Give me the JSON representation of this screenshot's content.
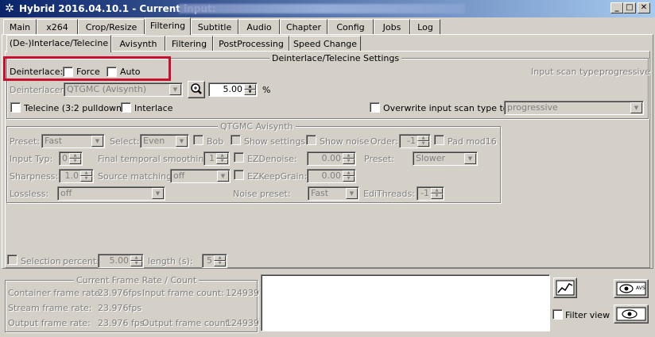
{
  "window": {
    "title": "Hybrid 2016.04.10.1 - Current input:"
  },
  "main_tabs": [
    "Main",
    "x264",
    "Crop/Resize",
    "Filtering",
    "Subtitle",
    "Audio",
    "Chapter",
    "Config",
    "Jobs",
    "Log"
  ],
  "sub_tabs": [
    "(De-)Interlace/Telecine",
    "Avisynth",
    "Filtering",
    "PostProcessing",
    "Speed Change"
  ],
  "deint": {
    "group_title": "Deinterlace/Telecine Settings",
    "deinterlace_label": "Deinterlace:",
    "force_label": "Force",
    "auto_label": "Auto",
    "input_scan_label": "Input scan type:",
    "input_scan_value": "progressive",
    "deinterlacer_label": "Deinterlacer:",
    "deinterlacer_value": "QTGMC (Avisynth)",
    "percent_value": "5.00",
    "percent_label": "%",
    "telecine_label": "Telecine (3:2 pulldown)",
    "interlace_label": "Interlace",
    "overwrite_label": "Overwrite input scan type to:",
    "overwrite_value": "progressive"
  },
  "qtgmc": {
    "group_title": "QTGMC Avisynth",
    "preset_label": "Preset:",
    "preset_value": "Fast",
    "select_label": "Select:",
    "select_value": "Even",
    "bob_label": "Bob",
    "show_settings_label": "Show settings",
    "show_noise_label": "Show noise",
    "order_label": "Order:",
    "order_value": "-1",
    "pad_label": "Pad mod16",
    "input_typ_label": "Input Typ:",
    "input_typ_value": "0",
    "fts_label": "Final temporal smoothing:",
    "fts_value": "1",
    "ezdenoise_label": "EZDenoise:",
    "ezdenoise_value": "0.00",
    "preset2_label": "Preset:",
    "preset2_value": "Slower",
    "sharpness_label": "Sharpness:",
    "sharpness_value": "1.0",
    "source_matching_label": "Source matching:",
    "source_matching_value": "off",
    "ezkeep_label": "EZKeepGrain:",
    "ezkeep_value": "0.00",
    "lossless_label": "Lossless:",
    "lossless_value": "off",
    "noise_preset_label": "Noise preset:",
    "noise_preset_value": "Fast",
    "edithreads_label": "EdiThreads:",
    "edithreads_value": "-1"
  },
  "selection": {
    "selection_label": "Selection",
    "percent_label": "percent:",
    "percent_value": "5.00",
    "length_label": "length (s):",
    "length_value": "5"
  },
  "frame_rate": {
    "group_title": "Current Frame Rate / Count",
    "container_label": "Container frame rate:",
    "container_value": "23.976fps",
    "input_count_label": "Input frame count:",
    "input_count_value": "124939",
    "stream_label": "Stream frame rate:",
    "stream_value": "23.976fps",
    "output_label": "Output frame rate:",
    "output_value": "23.976 fps",
    "output_count_label": "Output frame count:",
    "output_count_value": "124939"
  },
  "right_panel": {
    "filter_view_label": "Filter view",
    "avs_label": "AVS"
  },
  "colors": {
    "accent_red": "#c8102e",
    "titlebar": "#0a246a",
    "face": "#d4d0c8"
  }
}
